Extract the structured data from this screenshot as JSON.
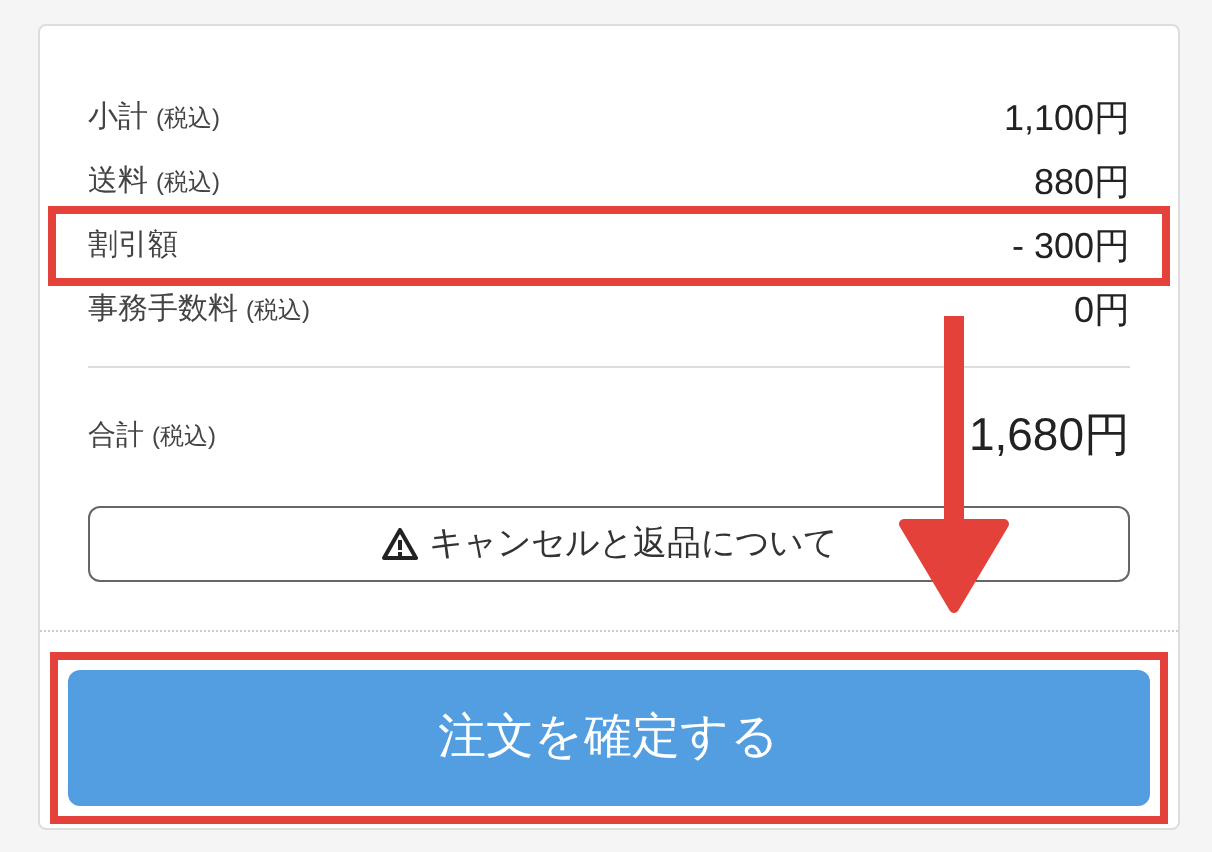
{
  "fees": [
    {
      "label": "小計",
      "note": "(税込)",
      "value": "1,100円",
      "highlighted": false
    },
    {
      "label": "送料",
      "note": "(税込)",
      "value": "880円",
      "highlighted": false
    },
    {
      "label": "割引額",
      "value": "- 300円",
      "highlighted": true
    },
    {
      "label": "事務手数料",
      "note": "(税込)",
      "value": "0円",
      "highlighted": false
    }
  ],
  "total": {
    "label": "合計",
    "note": "(税込)",
    "value": "1,680円"
  },
  "notice_button": {
    "label": "キャンセルと返品について"
  },
  "confirm_button": {
    "label": "注文を確定する",
    "highlighted": true
  }
}
